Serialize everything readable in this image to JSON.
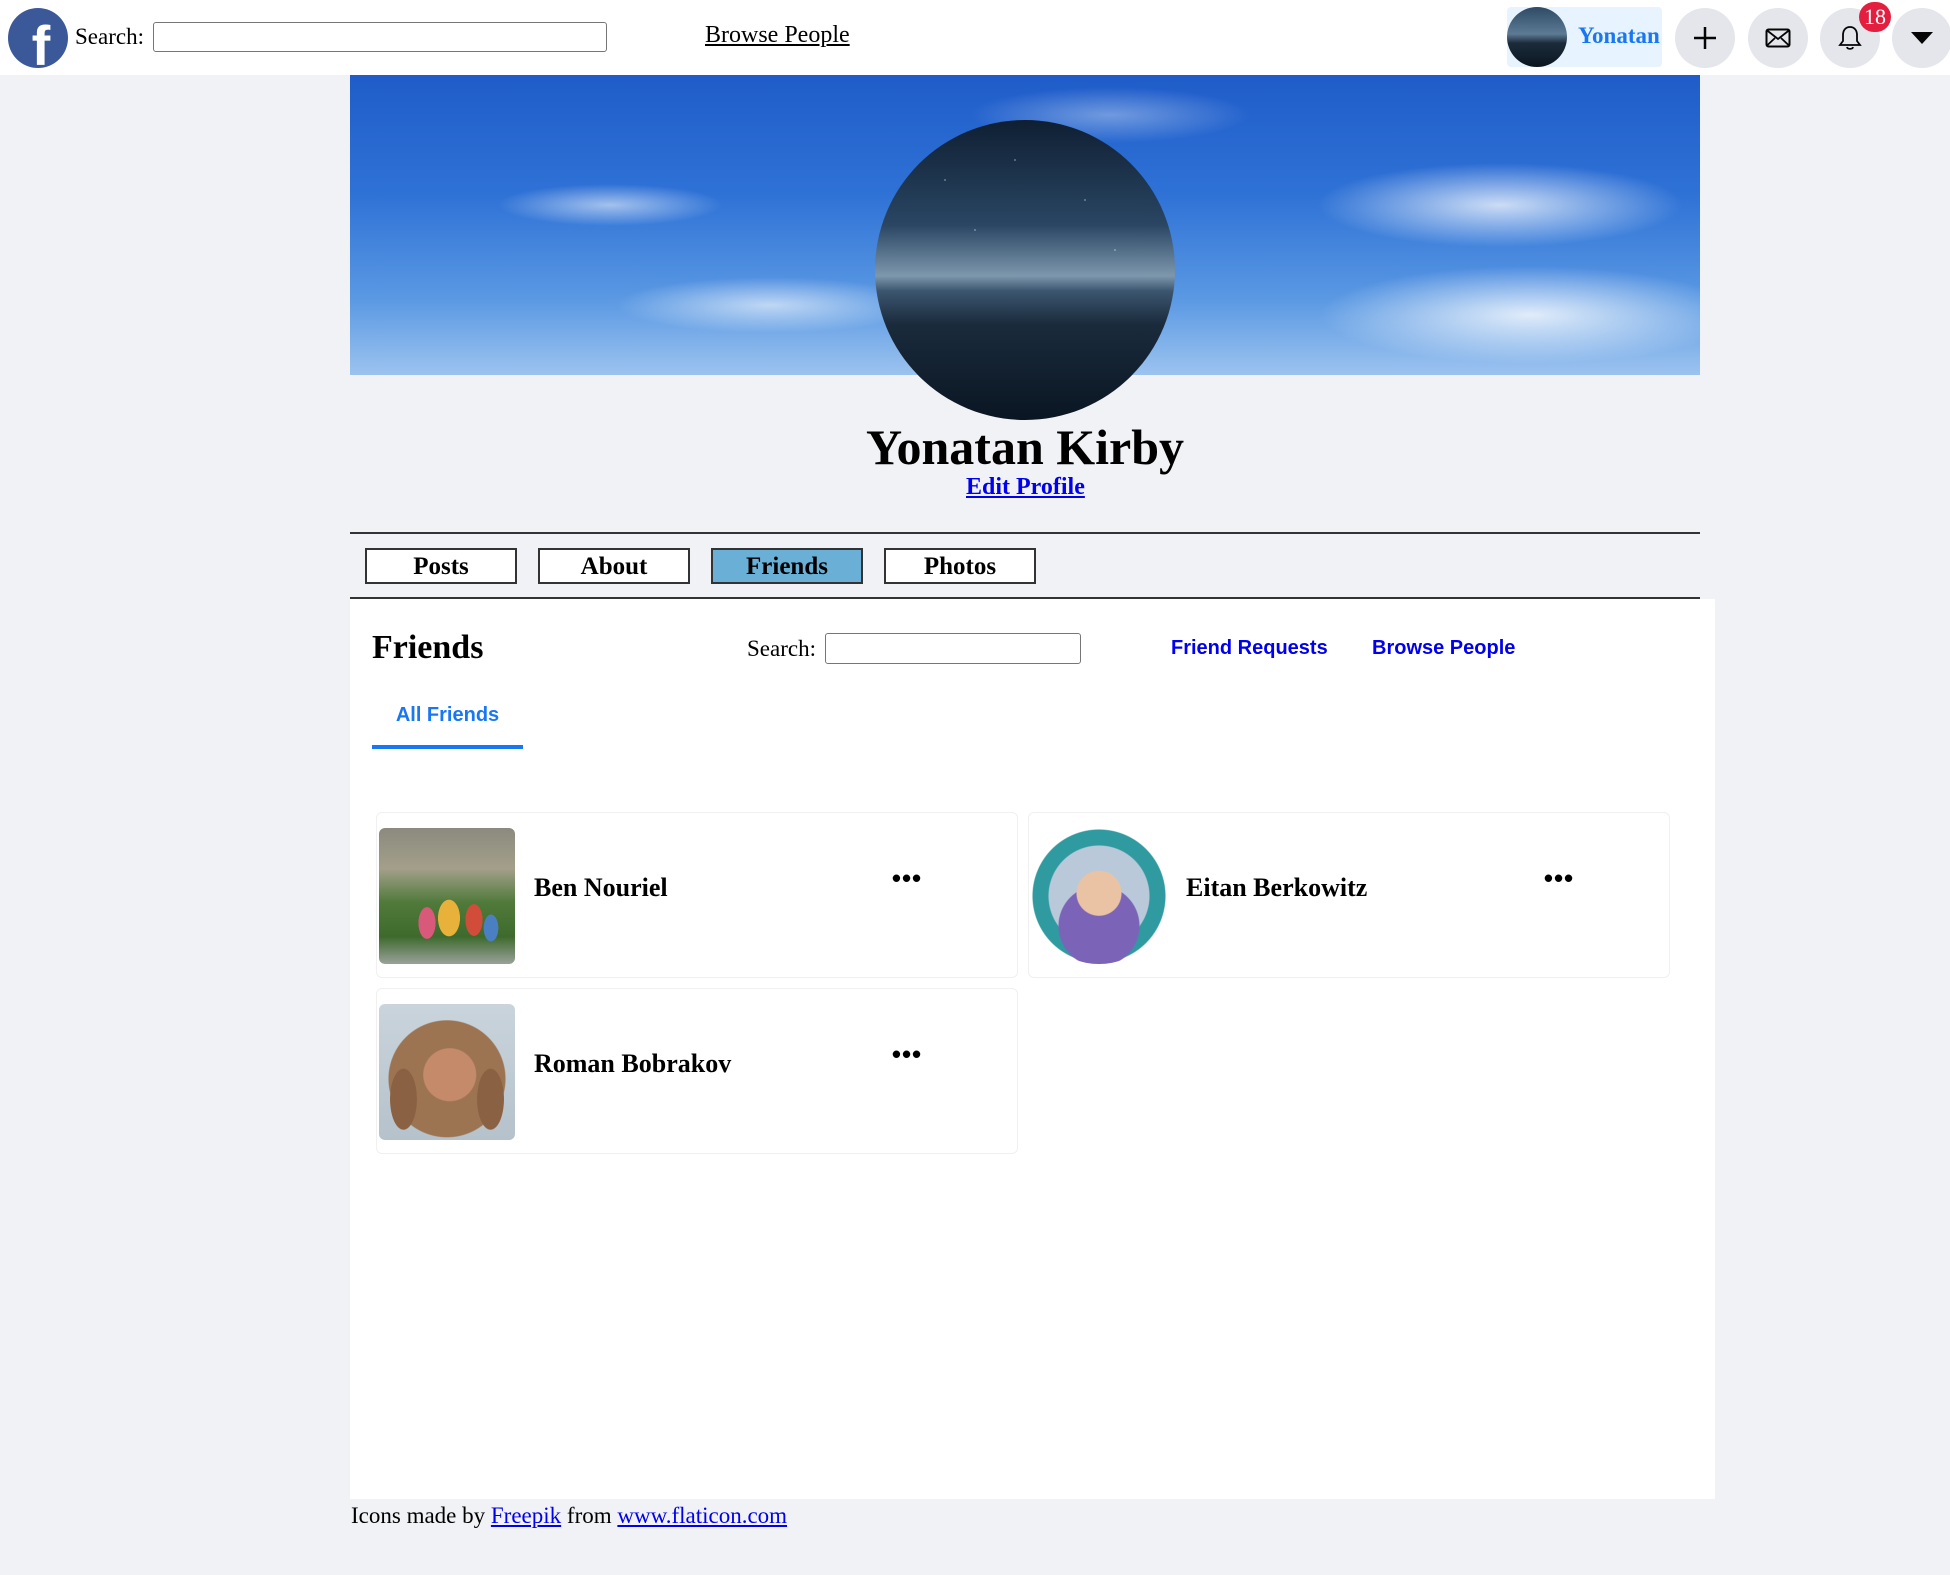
{
  "topbar": {
    "search_label": "Search:",
    "search_value": "",
    "browse_people": "Browse People",
    "user_name": "Yonatan",
    "notification_count": "18",
    "icons": [
      "facebook-logo-icon",
      "plus-icon",
      "mail-icon",
      "bell-icon",
      "caret-down-icon"
    ]
  },
  "profile": {
    "name": "Yonatan Kirby",
    "edit_link": "Edit Profile"
  },
  "tabs": [
    {
      "label": "Posts",
      "active": false
    },
    {
      "label": "About",
      "active": false
    },
    {
      "label": "Friends",
      "active": true
    },
    {
      "label": "Photos",
      "active": false
    }
  ],
  "friends_panel": {
    "title": "Friends",
    "search_label": "Search:",
    "search_value": "",
    "friend_requests_link": "Friend Requests",
    "browse_people_link": "Browse People",
    "subtab": "All Friends",
    "friends": [
      {
        "name": "Ben Nouriel",
        "menu": "•••"
      },
      {
        "name": "Eitan Berkowitz",
        "menu": "•••"
      },
      {
        "name": "Roman Bobrakov",
        "menu": "•••"
      }
    ]
  },
  "footer": {
    "prefix": "Icons made by",
    "author": "Freepik",
    "middle": "from",
    "site": "www.flaticon.com"
  },
  "colors": {
    "accent": "#1877f2",
    "active_tab": "#6ab0d6",
    "badge": "#e41e3f",
    "link": "#0000ee",
    "page_background": "#f0f2f5"
  }
}
